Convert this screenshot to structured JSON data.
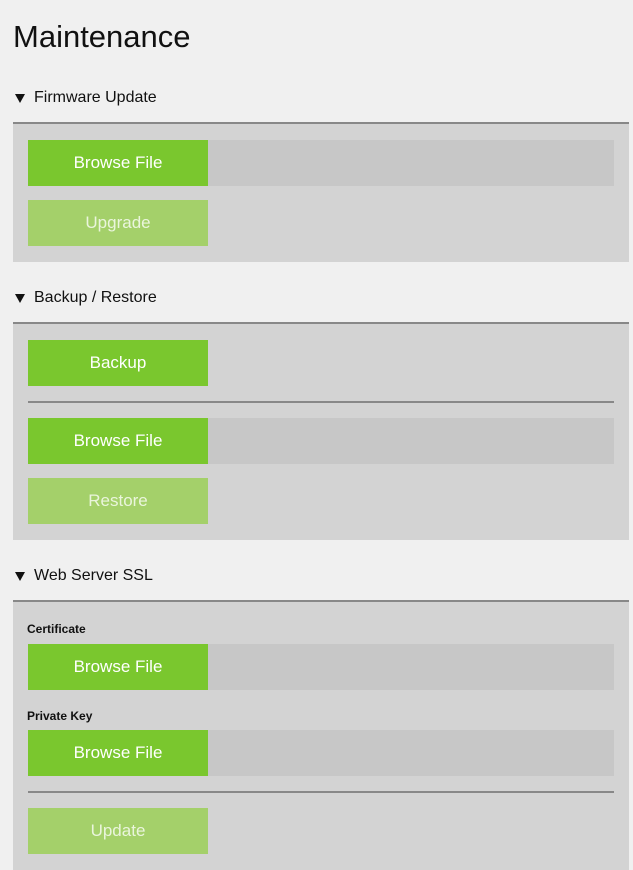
{
  "page": {
    "title": "Maintenance"
  },
  "colors": {
    "primary_button": "#7ac72e",
    "disabled_button": "#a4d06a",
    "panel_background": "#d3d3d3",
    "file_field_background": "#c7c7c7",
    "page_background": "#f0f0f0",
    "divider": "#888888"
  },
  "icons": {
    "section_toggle": "triangle-down-icon"
  },
  "firmware": {
    "header": "Firmware Update",
    "browse_label": "Browse File",
    "file_value": "",
    "upgrade_label": "Upgrade",
    "upgrade_enabled": false
  },
  "backup_restore": {
    "header": "Backup / Restore",
    "backup_label": "Backup",
    "browse_label": "Browse File",
    "file_value": "",
    "restore_label": "Restore",
    "restore_enabled": false
  },
  "ssl": {
    "header": "Web Server SSL",
    "certificate_label": "Certificate",
    "certificate_browse_label": "Browse File",
    "certificate_file_value": "",
    "private_key_label": "Private Key",
    "private_key_browse_label": "Browse File",
    "private_key_file_value": "",
    "update_label": "Update",
    "update_enabled": false
  }
}
